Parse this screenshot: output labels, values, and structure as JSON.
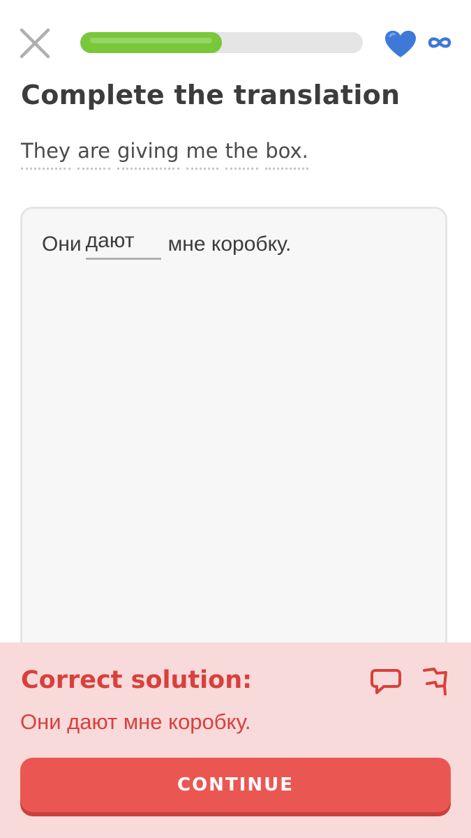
{
  "header": {
    "progress_fraction": 0.5,
    "infinite_hearts": true,
    "colors": {
      "progress": "#78c83a",
      "heart": "#3e79d8"
    }
  },
  "exercise": {
    "title": "Complete the translation",
    "prompt_words": [
      "They",
      "are",
      "giving",
      "me",
      "the",
      "box."
    ],
    "sentence_before": "Они",
    "blank_value": "дают",
    "sentence_after": "мне коробку."
  },
  "feedback": {
    "title": "Correct solution:",
    "answer": "Они дают мне коробку.",
    "continue_label": "CONTINUE",
    "colors": {
      "background": "#f8dadb",
      "text": "#d9403b",
      "button": "#ea5753"
    }
  },
  "icons": {
    "close": "close-icon",
    "heart": "heart-icon",
    "infinity": "infinity-icon",
    "comment": "comment-icon",
    "flag": "flag-icon"
  }
}
